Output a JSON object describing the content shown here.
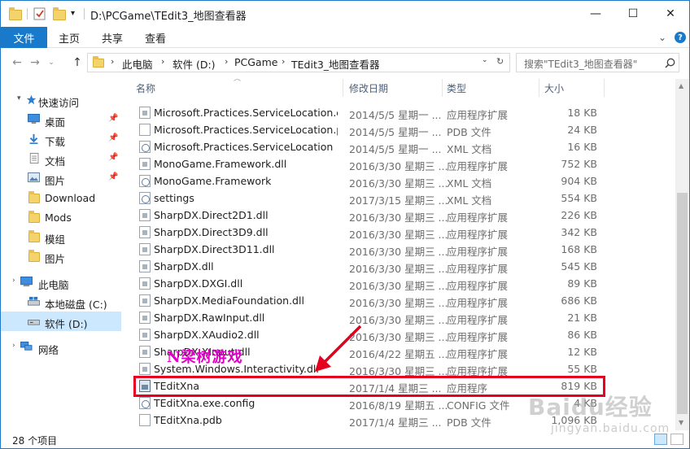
{
  "window": {
    "path": "D:\\PCGame\\TEdit3_地图查看器",
    "controls": {
      "minimize": "—",
      "maximize": "☐",
      "close": "✕"
    }
  },
  "ribbon": {
    "tabs": [
      "文件",
      "主页",
      "共享",
      "查看"
    ],
    "expand": "⌄",
    "help": "?"
  },
  "address": {
    "segments": [
      "此电脑",
      "软件 (D:)",
      "PCGame",
      "TEdit3_地图查看器"
    ],
    "refresh": "↻"
  },
  "search": {
    "placeholder": "搜索\"TEdit3_地图查看器\""
  },
  "nav": {
    "items": [
      {
        "label": "快速访问",
        "icon": "star-icon"
      },
      {
        "label": "桌面",
        "icon": "desktop-icon",
        "pinned": true
      },
      {
        "label": "下载",
        "icon": "download-icon",
        "pinned": true
      },
      {
        "label": "文档",
        "icon": "document-icon",
        "pinned": true
      },
      {
        "label": "图片",
        "icon": "pictures-icon",
        "pinned": true
      },
      {
        "label": "Download",
        "icon": "folder-icon"
      },
      {
        "label": "Mods",
        "icon": "folder-icon"
      },
      {
        "label": "模组",
        "icon": "folder-icon"
      },
      {
        "label": "图片",
        "icon": "folder-icon"
      },
      {
        "label": "此电脑",
        "icon": "computer-icon"
      },
      {
        "label": "本地磁盘 (C:)",
        "icon": "drive-icon"
      },
      {
        "label": "软件 (D:)",
        "icon": "drive-icon",
        "selected": true
      },
      {
        "label": "网络",
        "icon": "network-icon"
      }
    ]
  },
  "columns": {
    "name": "名称",
    "date": "修改日期",
    "type": "类型",
    "size": "大小"
  },
  "files": [
    {
      "name": "Microsoft.Practices.ServiceLocation.dll",
      "date": "2014/5/5 星期一 ...",
      "type": "应用程序扩展",
      "size": "18 KB",
      "kind": "dll"
    },
    {
      "name": "Microsoft.Practices.ServiceLocation.p...",
      "date": "2014/5/5 星期一 ...",
      "type": "PDB 文件",
      "size": "24 KB",
      "kind": "doc"
    },
    {
      "name": "Microsoft.Practices.ServiceLocation",
      "date": "2014/5/5 星期一 ...",
      "type": "XML 文档",
      "size": "16 KB",
      "kind": "cfg"
    },
    {
      "name": "MonoGame.Framework.dll",
      "date": "2016/3/30 星期三 ...",
      "type": "应用程序扩展",
      "size": "752 KB",
      "kind": "dll"
    },
    {
      "name": "MonoGame.Framework",
      "date": "2016/3/30 星期三 ...",
      "type": "XML 文档",
      "size": "904 KB",
      "kind": "cfg"
    },
    {
      "name": "settings",
      "date": "2017/3/15 星期三 ...",
      "type": "XML 文档",
      "size": "554 KB",
      "kind": "cfg"
    },
    {
      "name": "SharpDX.Direct2D1.dll",
      "date": "2016/3/30 星期三 ...",
      "type": "应用程序扩展",
      "size": "226 KB",
      "kind": "dll"
    },
    {
      "name": "SharpDX.Direct3D9.dll",
      "date": "2016/3/30 星期三 ...",
      "type": "应用程序扩展",
      "size": "342 KB",
      "kind": "dll"
    },
    {
      "name": "SharpDX.Direct3D11.dll",
      "date": "2016/3/30 星期三 ...",
      "type": "应用程序扩展",
      "size": "168 KB",
      "kind": "dll"
    },
    {
      "name": "SharpDX.dll",
      "date": "2016/3/30 星期三 ...",
      "type": "应用程序扩展",
      "size": "545 KB",
      "kind": "dll"
    },
    {
      "name": "SharpDX.DXGI.dll",
      "date": "2016/3/30 星期三 ...",
      "type": "应用程序扩展",
      "size": "89 KB",
      "kind": "dll"
    },
    {
      "name": "SharpDX.MediaFoundation.dll",
      "date": "2016/3/30 星期三 ...",
      "type": "应用程序扩展",
      "size": "686 KB",
      "kind": "dll"
    },
    {
      "name": "SharpDX.RawInput.dll",
      "date": "2016/3/30 星期三 ...",
      "type": "应用程序扩展",
      "size": "21 KB",
      "kind": "dll"
    },
    {
      "name": "SharpDX.XAudio2.dll",
      "date": "2016/3/30 星期三 ...",
      "type": "应用程序扩展",
      "size": "86 KB",
      "kind": "dll"
    },
    {
      "name": "SharpDX.XInput.dll",
      "date": "2016/4/22 星期五 ...",
      "type": "应用程序扩展",
      "size": "12 KB",
      "kind": "dll"
    },
    {
      "name": "System.Windows.Interactivity.dll",
      "date": "2016/3/30 星期三 ...",
      "type": "应用程序扩展",
      "size": "55 KB",
      "kind": "dll"
    },
    {
      "name": "TEditXna",
      "date": "2017/1/4 星期三 ...",
      "type": "应用程序",
      "size": "819 KB",
      "kind": "exe",
      "highlight": true
    },
    {
      "name": "TEditXna.exe.config",
      "date": "2016/8/19 星期五 ...",
      "type": "CONFIG 文件",
      "size": "4 KB",
      "kind": "cfg"
    },
    {
      "name": "TEditXna.pdb",
      "date": "2017/1/4 星期三 ...",
      "type": "PDB 文件",
      "size": "1,096 KB",
      "kind": "doc"
    }
  ],
  "status": {
    "count": "28 个项目"
  },
  "annotation": {
    "text": "N梁树游戏"
  },
  "watermark": {
    "text": "Baidu经验",
    "sub": "jingyan.baidu.com"
  },
  "colors": {
    "accent": "#1979ca",
    "highlight": "#e6001f",
    "annotation": "#e000c8"
  }
}
